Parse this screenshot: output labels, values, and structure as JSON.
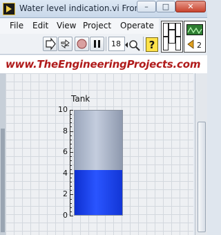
{
  "window": {
    "title": "Water level indication.vi Fron...",
    "buttons": {
      "minimize": "–",
      "maximize": "□",
      "close": "✕"
    }
  },
  "menu": [
    "File",
    "Edit",
    "View",
    "Project",
    "Operate"
  ],
  "toolbar": {
    "font_size": "18",
    "icons": [
      "run-arrow-icon",
      "run-continuously-icon",
      "abort-icon",
      "pause-icon",
      "font-size-icon",
      "zoom-icon",
      "help-icon"
    ]
  },
  "connector": {
    "number": "2"
  },
  "banner": {
    "text": "www.TheEngineeringProjects.com",
    "color": "#b01b1b"
  },
  "tank": {
    "label": "Tank",
    "scale_min": 0,
    "scale_max": 10,
    "ticks": [
      "10",
      "8",
      "6",
      "4",
      "2",
      "0"
    ],
    "level": 4.3,
    "fill_color": "#1a3ef0"
  }
}
